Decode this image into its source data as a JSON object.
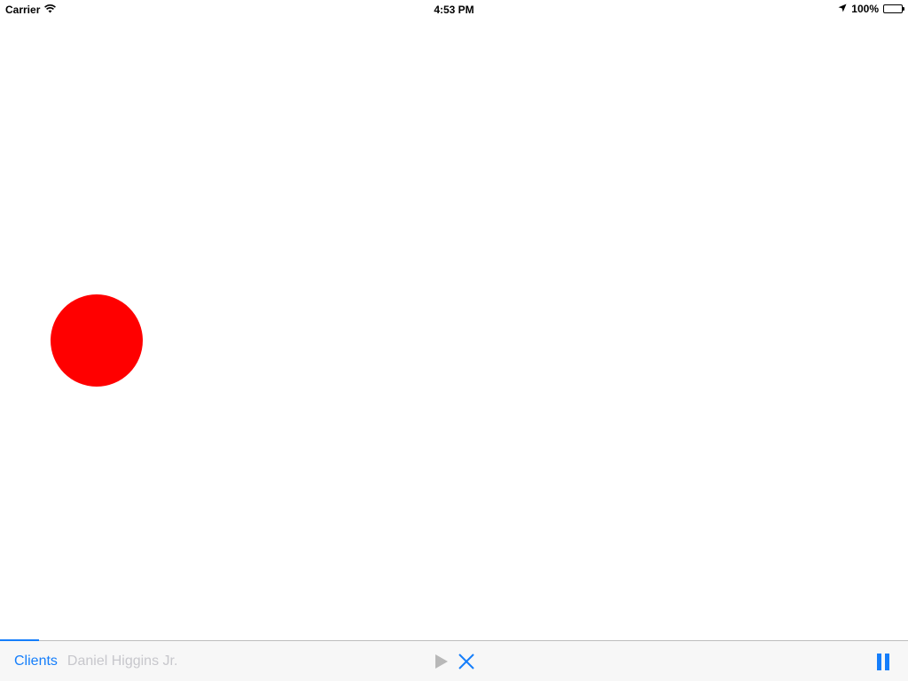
{
  "status_bar": {
    "carrier": "Carrier",
    "time": "4:53 PM",
    "battery_percent": "100%",
    "battery_level": 1.0,
    "icons": {
      "wifi": "wifi-icon",
      "location": "location-arrow-icon",
      "battery": "battery-icon"
    }
  },
  "canvas": {
    "shape": "circle",
    "color": "#ff0000"
  },
  "toolbar": {
    "crumbs": [
      {
        "label": "Clients",
        "color": "#157efb"
      },
      {
        "label": "Daniel Higgins Jr.",
        "color": "#c7c7cc"
      }
    ],
    "progress": 0.043,
    "accent_color": "#157efb",
    "play_color": "#b8b8b8",
    "icons": {
      "play": "play-icon",
      "close": "close-icon",
      "pause": "pause-icon"
    }
  }
}
